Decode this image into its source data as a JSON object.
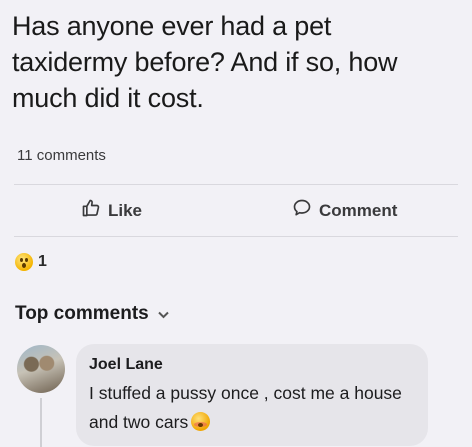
{
  "post": {
    "text": "Has anyone ever had a pet taxidermy before? And if so, how much did it cost.",
    "comment_count": "11 comments"
  },
  "actions": {
    "like_label": "Like",
    "comment_label": "Comment"
  },
  "reactions": {
    "icon": "wow-emoji-icon",
    "count": "1"
  },
  "comments_section": {
    "sort_label": "Top comments",
    "comments": [
      {
        "author": "Joel Lane",
        "text": "I stuffed a pussy once , cost me a house and two cars",
        "emoji": "flushed-emoji-icon"
      }
    ]
  }
}
